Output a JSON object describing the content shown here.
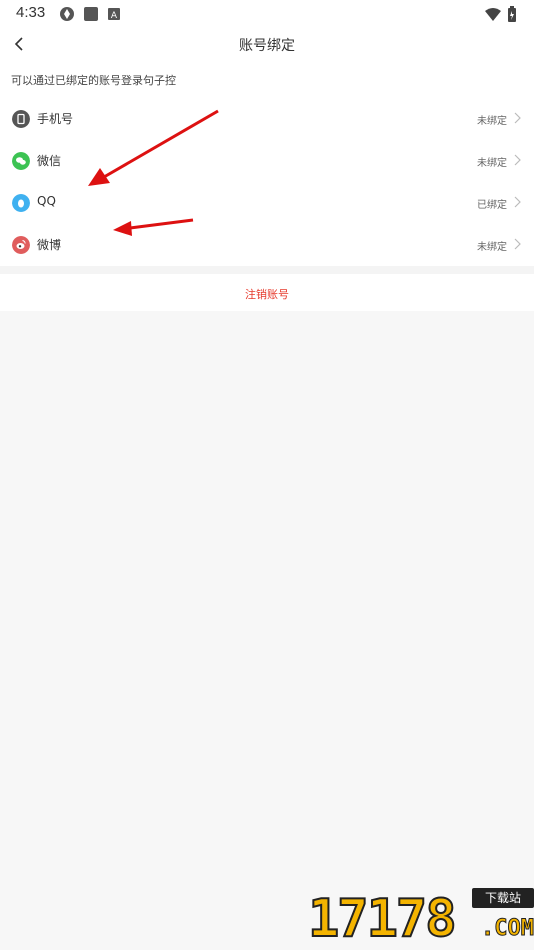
{
  "status_bar": {
    "time": "4:33",
    "left_icons": [
      "app-icon",
      "square-icon",
      "a-icon"
    ],
    "right_icons": [
      "wifi-icon",
      "battery-icon"
    ]
  },
  "header": {
    "title": "账号绑定",
    "back_icon": "back-chevron-icon"
  },
  "hint": "可以通过已绑定的账号登录句子控",
  "bind_items": [
    {
      "label": "手机号",
      "status": "未绑定",
      "icon": "phone-icon",
      "icon_color": "#555555"
    },
    {
      "label": "微信",
      "status": "未绑定",
      "icon": "wechat-icon",
      "icon_color": "#3cc353"
    },
    {
      "label": "QQ",
      "status": "已绑定",
      "icon": "qq-icon",
      "icon_color": "#3fb1f0"
    },
    {
      "label": "微博",
      "status": "未绑定",
      "icon": "weibo-icon",
      "icon_color": "#e05d5d"
    }
  ],
  "cancel_account": "注销账号",
  "colors": {
    "accent_red": "#e6392b",
    "background": "#f7f7f7"
  },
  "watermark": {
    "digits": "17178",
    "badge": "下载站",
    "suffix": ".COM"
  }
}
